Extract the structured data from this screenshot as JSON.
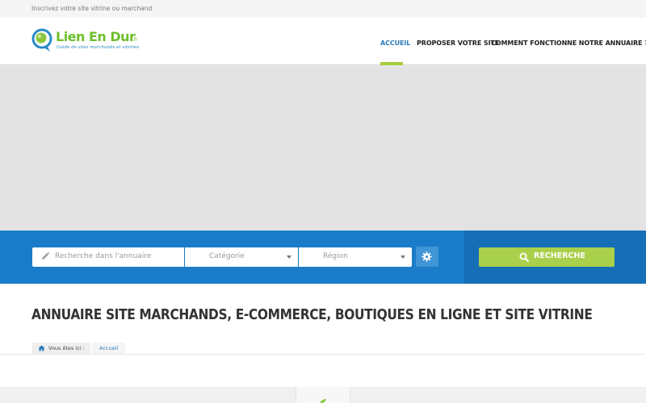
{
  "topbar": {
    "text": "Inscrivez votre site vitrine ou marchand"
  },
  "logo": {
    "name": "Lien En Dur",
    "suffix": ".fr",
    "tagline": "Guide de sites marchands et vitrines"
  },
  "nav": {
    "items": [
      {
        "label": "ACCUEIL",
        "active": true
      },
      {
        "label": "PROPOSER VOTRE SITE",
        "active": false
      },
      {
        "label": "COMMENT FONCTIONNE NOTRE ANNUAIRE ?",
        "active": false
      }
    ]
  },
  "search": {
    "placeholder": "Recherche dans l'annuaire",
    "category": "Catégorie",
    "region": "Région",
    "button_label": "RECHERCHE"
  },
  "page": {
    "title": "ANNUAIRE SITE MARCHANDS, E-COMMERCE, BOUTIQUES EN LIGNE ET SITE VITRINE"
  },
  "breadcrumb": {
    "prefix": "Vous êtes ici :",
    "items": [
      "Accueil"
    ]
  },
  "colors": {
    "brand_green": "#6dbf2a",
    "accent_blue": "#1a7cc8",
    "button_green": "#a9d04b",
    "nav_active": "#2a7ab8"
  },
  "icons": [
    "pencil-icon",
    "caret-down-icon",
    "gear-icon",
    "search-icon",
    "home-icon"
  ]
}
